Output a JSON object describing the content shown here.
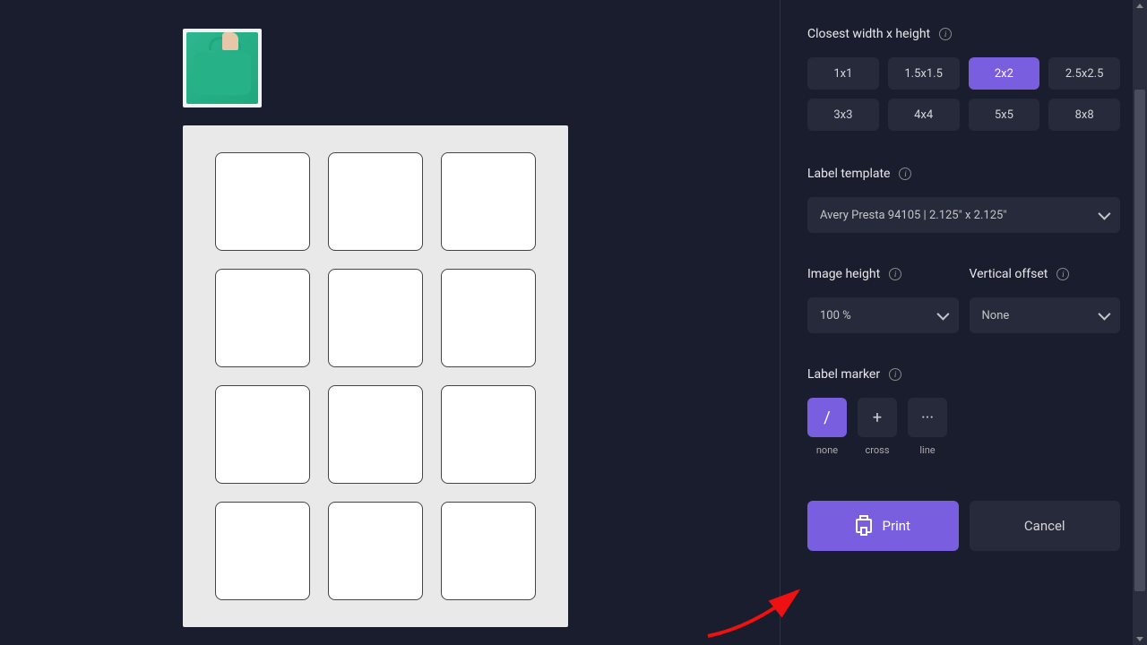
{
  "sizeSection": {
    "label": "Closest width x height",
    "options": [
      "1x1",
      "1.5x1.5",
      "2x2",
      "2.5x2.5",
      "3x3",
      "4x4",
      "5x5",
      "8x8"
    ],
    "selected": "2x2"
  },
  "templateSection": {
    "label": "Label template",
    "value": "Avery Presta 94105 | 2.125\" x 2.125\""
  },
  "imageHeight": {
    "label": "Image height",
    "value": "100 %"
  },
  "verticalOffset": {
    "label": "Vertical offset",
    "value": "None"
  },
  "markerSection": {
    "label": "Label marker",
    "options": [
      {
        "symbol": "/",
        "name": "none"
      },
      {
        "symbol": "+",
        "name": "cross"
      },
      {
        "symbol": "···",
        "name": "line"
      }
    ],
    "selected": "none"
  },
  "actions": {
    "print": "Print",
    "cancel": "Cancel"
  },
  "preview": {
    "rows": 4,
    "cols": 3
  }
}
